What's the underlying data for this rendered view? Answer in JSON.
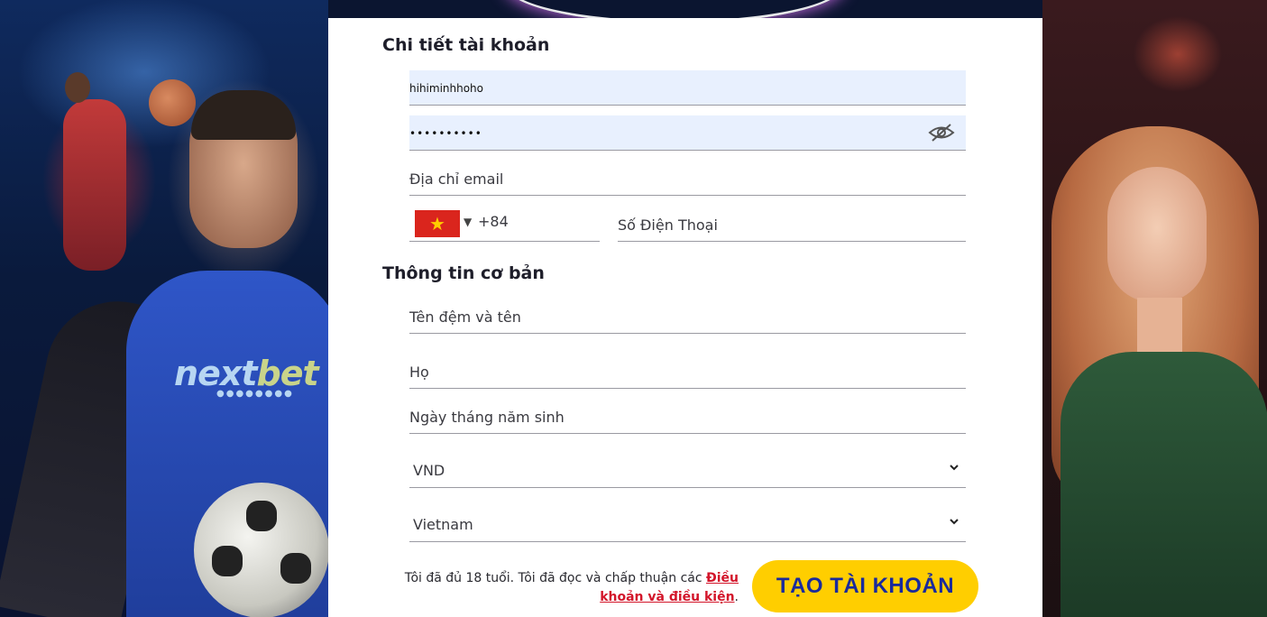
{
  "brand": {
    "name_part1": "next",
    "name_part2": "bet",
    "dots": "●●●●●●●●"
  },
  "account_section": {
    "title": "Chi tiết tài khoản",
    "username_value": "hihiminhhoho",
    "password_mask": "••••••••••",
    "email_placeholder": "Địa chỉ email",
    "phone_code": "+84",
    "phone_placeholder": "Số Điện Thoại",
    "flag_icon": "vietnam-flag-icon",
    "flag_star": "★",
    "dropdown_arrow": "▼"
  },
  "basic_section": {
    "title": "Thông tin cơ bản",
    "given_name_placeholder": "Tên đệm và tên",
    "family_name_placeholder": "Họ",
    "dob_placeholder": "Ngày tháng năm sinh",
    "currency_value": "VND",
    "country_value": "Vietnam"
  },
  "terms": {
    "prefix": "Tôi đã đủ 18 tuổi. Tôi đã đọc và chấp thuận các ",
    "link": "Điều khoản và điều kiện",
    "suffix": "."
  },
  "cta_label": "TẠO TÀI KHOẢN",
  "colors": {
    "cta_bg": "#ffce00",
    "cta_text": "#1a2a9c",
    "link": "#d3152a",
    "autofill": "#e8f0fe"
  }
}
